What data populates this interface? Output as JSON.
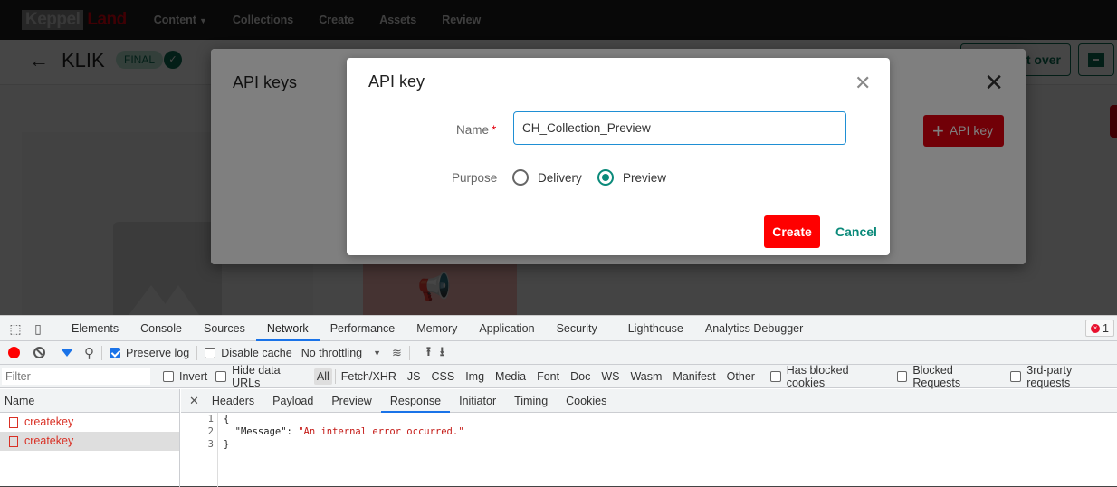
{
  "app": {
    "logo": {
      "part1": "Keppel",
      "part2": "Land"
    },
    "nav": [
      {
        "label": "Content",
        "has_dropdown": true
      },
      {
        "label": "Collections"
      },
      {
        "label": "Create"
      },
      {
        "label": "Assets"
      },
      {
        "label": "Review"
      }
    ],
    "header": {
      "back_icon": "arrow-left-icon",
      "title": "KLIK",
      "status_badge": "FINAL",
      "cloud_icon": "cloud-check-icon",
      "start_over_label": "Start over",
      "archive_icon": "archive-icon"
    }
  },
  "api_keys_modal": {
    "title": "API keys",
    "close_icon": "close-icon",
    "add_button_label": "API key",
    "add_icon": "plus-icon"
  },
  "api_key_dialog": {
    "title": "API key",
    "close_icon": "close-icon",
    "name_label": "Name",
    "required_mark": "*",
    "name_value": "CH_Collection_Preview",
    "purpose_label": "Purpose",
    "purpose_options": [
      {
        "label": "Delivery",
        "selected": false
      },
      {
        "label": "Preview",
        "selected": true
      }
    ],
    "create_label": "Create",
    "cancel_label": "Cancel",
    "colors": {
      "primary": "#ff0000",
      "accent": "#0b8a7a",
      "focus": "#1f8fd4"
    }
  },
  "devtools": {
    "tabs": [
      "Elements",
      "Console",
      "Sources",
      "Network",
      "Performance",
      "Memory",
      "Application",
      "Security",
      "Lighthouse",
      "Analytics Debugger"
    ],
    "active_tab": "Network",
    "error_count": "1",
    "toolbar": {
      "preserve_log": {
        "label": "Preserve log",
        "checked": true
      },
      "disable_cache": {
        "label": "Disable cache",
        "checked": false
      },
      "throttling": "No throttling"
    },
    "filter": {
      "placeholder": "Filter",
      "invert_label": "Invert",
      "hide_data_urls_label": "Hide data URLs",
      "types": [
        "All",
        "Fetch/XHR",
        "JS",
        "CSS",
        "Img",
        "Media",
        "Font",
        "Doc",
        "WS",
        "Wasm",
        "Manifest",
        "Other"
      ],
      "active_type": "All",
      "has_blocked_cookies_label": "Has blocked cookies",
      "blocked_requests_label": "Blocked Requests",
      "third_party_label": "3rd-party requests"
    },
    "requests": {
      "header": "Name",
      "rows": [
        {
          "name": "createkey",
          "selected": false
        },
        {
          "name": "createkey",
          "selected": true
        }
      ]
    },
    "detail": {
      "tabs": [
        "Headers",
        "Payload",
        "Preview",
        "Response",
        "Initiator",
        "Timing",
        "Cookies"
      ],
      "active_tab": "Response",
      "response_lines": [
        {
          "no": "1",
          "text": "{"
        },
        {
          "no": "2",
          "key": "  \"Message\": ",
          "value": "\"An internal error occurred.\""
        },
        {
          "no": "3",
          "text": "}"
        }
      ]
    }
  }
}
